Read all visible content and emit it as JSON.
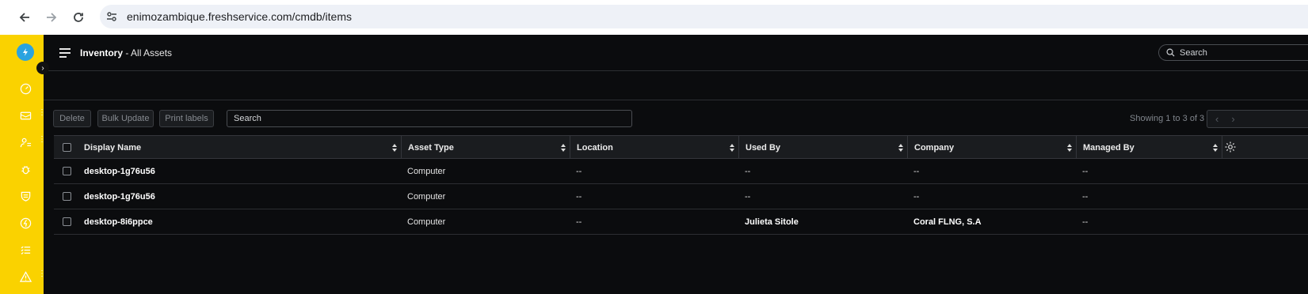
{
  "browser": {
    "url": "enimozambique.freshservice.com/cmdb/items"
  },
  "sidebar": {
    "logo": "freshservice-logo",
    "items": [
      {
        "icon": "dashboard-icon"
      },
      {
        "icon": "tickets-icon"
      },
      {
        "icon": "contacts-icon"
      },
      {
        "icon": "problems-icon"
      },
      {
        "icon": "changes-icon"
      },
      {
        "icon": "releases-icon"
      },
      {
        "icon": "tasks-icon"
      },
      {
        "icon": "alerts-icon"
      }
    ]
  },
  "header": {
    "title_bold": "Inventory",
    "title_rest": " - All Assets",
    "search_placeholder": "Search"
  },
  "toolbar": {
    "delete_label": "Delete",
    "bulk_update_label": "Bulk Update",
    "print_labels_label": "Print labels",
    "search_placeholder": "Search",
    "showing": "Showing 1 to 3 of 3"
  },
  "table": {
    "columns": [
      "Display Name",
      "Asset Type",
      "Location",
      "Used By",
      "Company",
      "Managed By"
    ],
    "rows": [
      [
        "desktop-1g76u56",
        "Computer",
        "--",
        "--",
        "--",
        "--"
      ],
      [
        "desktop-1g76u56",
        "Computer",
        "--",
        "--",
        "--",
        "--"
      ],
      [
        "desktop-8i6ppce",
        "Computer",
        "--",
        "Julieta Sitole",
        "Coral FLNG, S.A",
        "--"
      ]
    ]
  },
  "colors": {
    "sidebar": "#fad200",
    "background": "#0b0c0e",
    "logo": "#2aa3e0"
  }
}
